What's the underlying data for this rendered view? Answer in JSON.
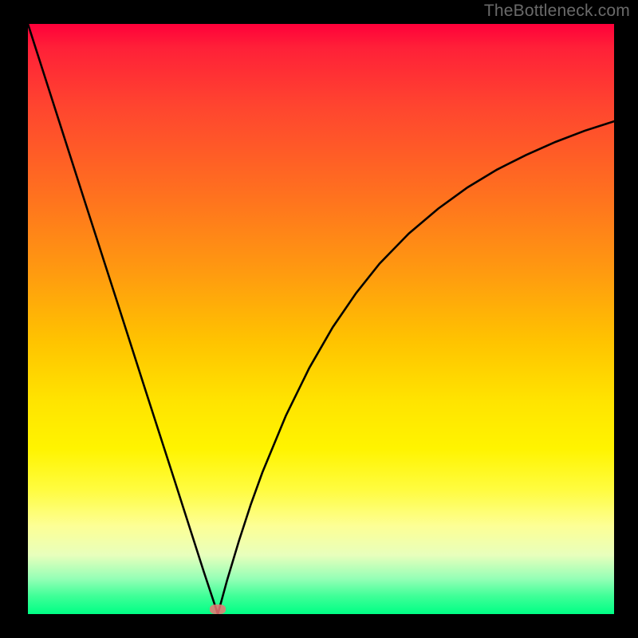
{
  "watermark": "TheBottleneck.com",
  "colors": {
    "black": "#000000",
    "curve": "#000000",
    "marker": "#ee7474",
    "gradient_top": "#ff003a",
    "gradient_bottom": "#00ff85"
  },
  "chart_data": {
    "type": "line",
    "title": "",
    "xlabel": "",
    "ylabel": "",
    "xlim": [
      0,
      100
    ],
    "ylim": [
      0,
      100
    ],
    "grid": false,
    "legend": false,
    "annotations": [],
    "series": [
      {
        "name": "left-branch",
        "x": [
          0,
          5,
          10,
          15,
          20,
          25,
          30,
          32.4
        ],
        "values": [
          100,
          84.5,
          69,
          53.6,
          38.1,
          22.7,
          7.2,
          0
        ]
      },
      {
        "name": "right-branch",
        "x": [
          32.4,
          34,
          36,
          38,
          40,
          44,
          48,
          52,
          56,
          60,
          65,
          70,
          75,
          80,
          85,
          90,
          95,
          100
        ],
        "values": [
          0,
          5.8,
          12.4,
          18.5,
          24.0,
          33.6,
          41.7,
          48.6,
          54.4,
          59.4,
          64.5,
          68.7,
          72.3,
          75.3,
          77.8,
          80.0,
          81.9,
          83.5
        ]
      }
    ],
    "marker": {
      "x": 32.4,
      "y": 0.8
    },
    "background_gradient": {
      "orientation": "vertical",
      "stops": [
        {
          "pos": 0.0,
          "color": "#ff003a"
        },
        {
          "pos": 0.14,
          "color": "#ff452f"
        },
        {
          "pos": 0.42,
          "color": "#ff9a10"
        },
        {
          "pos": 0.64,
          "color": "#ffe400"
        },
        {
          "pos": 0.85,
          "color": "#fdff95"
        },
        {
          "pos": 1.0,
          "color": "#00ff85"
        }
      ]
    }
  }
}
